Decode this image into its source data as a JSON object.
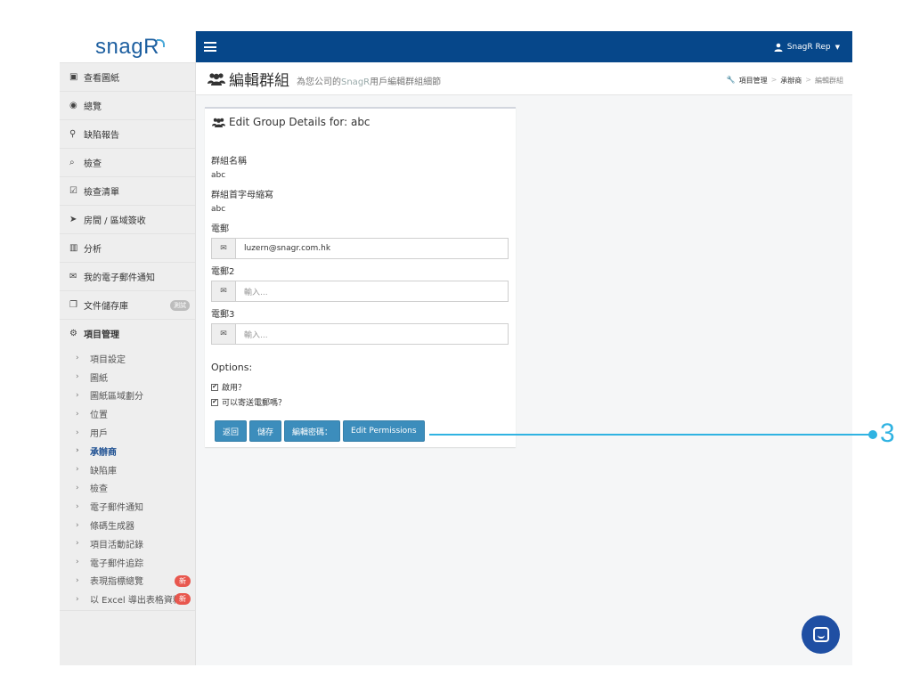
{
  "logo": {
    "prefix": "snag",
    "r": "R"
  },
  "sidebar": {
    "items": [
      {
        "icon": "▣",
        "label": "查看圖紙"
      },
      {
        "icon": "◉",
        "label": "總覽"
      },
      {
        "icon": "⚲",
        "label": "缺陷報告"
      },
      {
        "icon": "⌕",
        "label": "檢查"
      },
      {
        "icon": "☑",
        "label": "檢查清單"
      },
      {
        "icon": "➤",
        "label": "房間 / 區域簽收"
      },
      {
        "icon": "▥",
        "label": "分析"
      },
      {
        "icon": "✉",
        "label": "我的電子郵件通知"
      },
      {
        "icon": "❐",
        "label": "文件儲存庫",
        "badge": "測試"
      },
      {
        "icon": "⚙",
        "label": "項目管理"
      }
    ],
    "sub_items": [
      {
        "label": "項目設定"
      },
      {
        "label": "圖紙"
      },
      {
        "label": "圖紙區域劃分"
      },
      {
        "label": "位置"
      },
      {
        "label": "用戶"
      },
      {
        "label": "承辦商"
      },
      {
        "label": "缺陷庫"
      },
      {
        "label": "檢查"
      },
      {
        "label": "電子郵件通知"
      },
      {
        "label": "條碼生成器"
      },
      {
        "label": "項目活動記錄"
      },
      {
        "label": "電子郵件追踪"
      },
      {
        "label": "表現指標總覽",
        "badge": "新"
      },
      {
        "label": "以 Excel 導出表格資料",
        "badge": "新"
      }
    ]
  },
  "topbar": {
    "user": "SnagR Rep"
  },
  "header": {
    "title": "編輯群組",
    "subtitle_pre": "為您公司的",
    "subtitle_brand": "SnagR",
    "subtitle_post": "用戶編輯群組細節",
    "breadcrumb": [
      "項目管理",
      "承辦商",
      "編輯群組"
    ]
  },
  "card": {
    "title": "Edit Group Details for: abc",
    "group_name_label": "群組名稱",
    "group_name_value": "abc",
    "initials_label": "群組首字母縮寫",
    "initials_value": "abc",
    "email1_label": "電郵",
    "email1_value": "luzern@snagr.com.hk",
    "email2_label": "電郵2",
    "email2_placeholder": "輸入...",
    "email3_label": "電郵3",
    "email3_placeholder": "輸入...",
    "options_title": "Options:",
    "opt_enabled": "啟用？",
    "opt_send_email": "可以寄送電郵嗎？",
    "buttons": {
      "back": "返回",
      "save": "儲存",
      "edit_password": "編輯密碼：",
      "edit_permissions": "Edit Permissions"
    }
  },
  "callout": {
    "number": "3"
  },
  "colors": {
    "topbar": "#06478a",
    "button": "#3c8dbc",
    "callout": "#30b3e2",
    "badge_new": "#e8574e"
  }
}
